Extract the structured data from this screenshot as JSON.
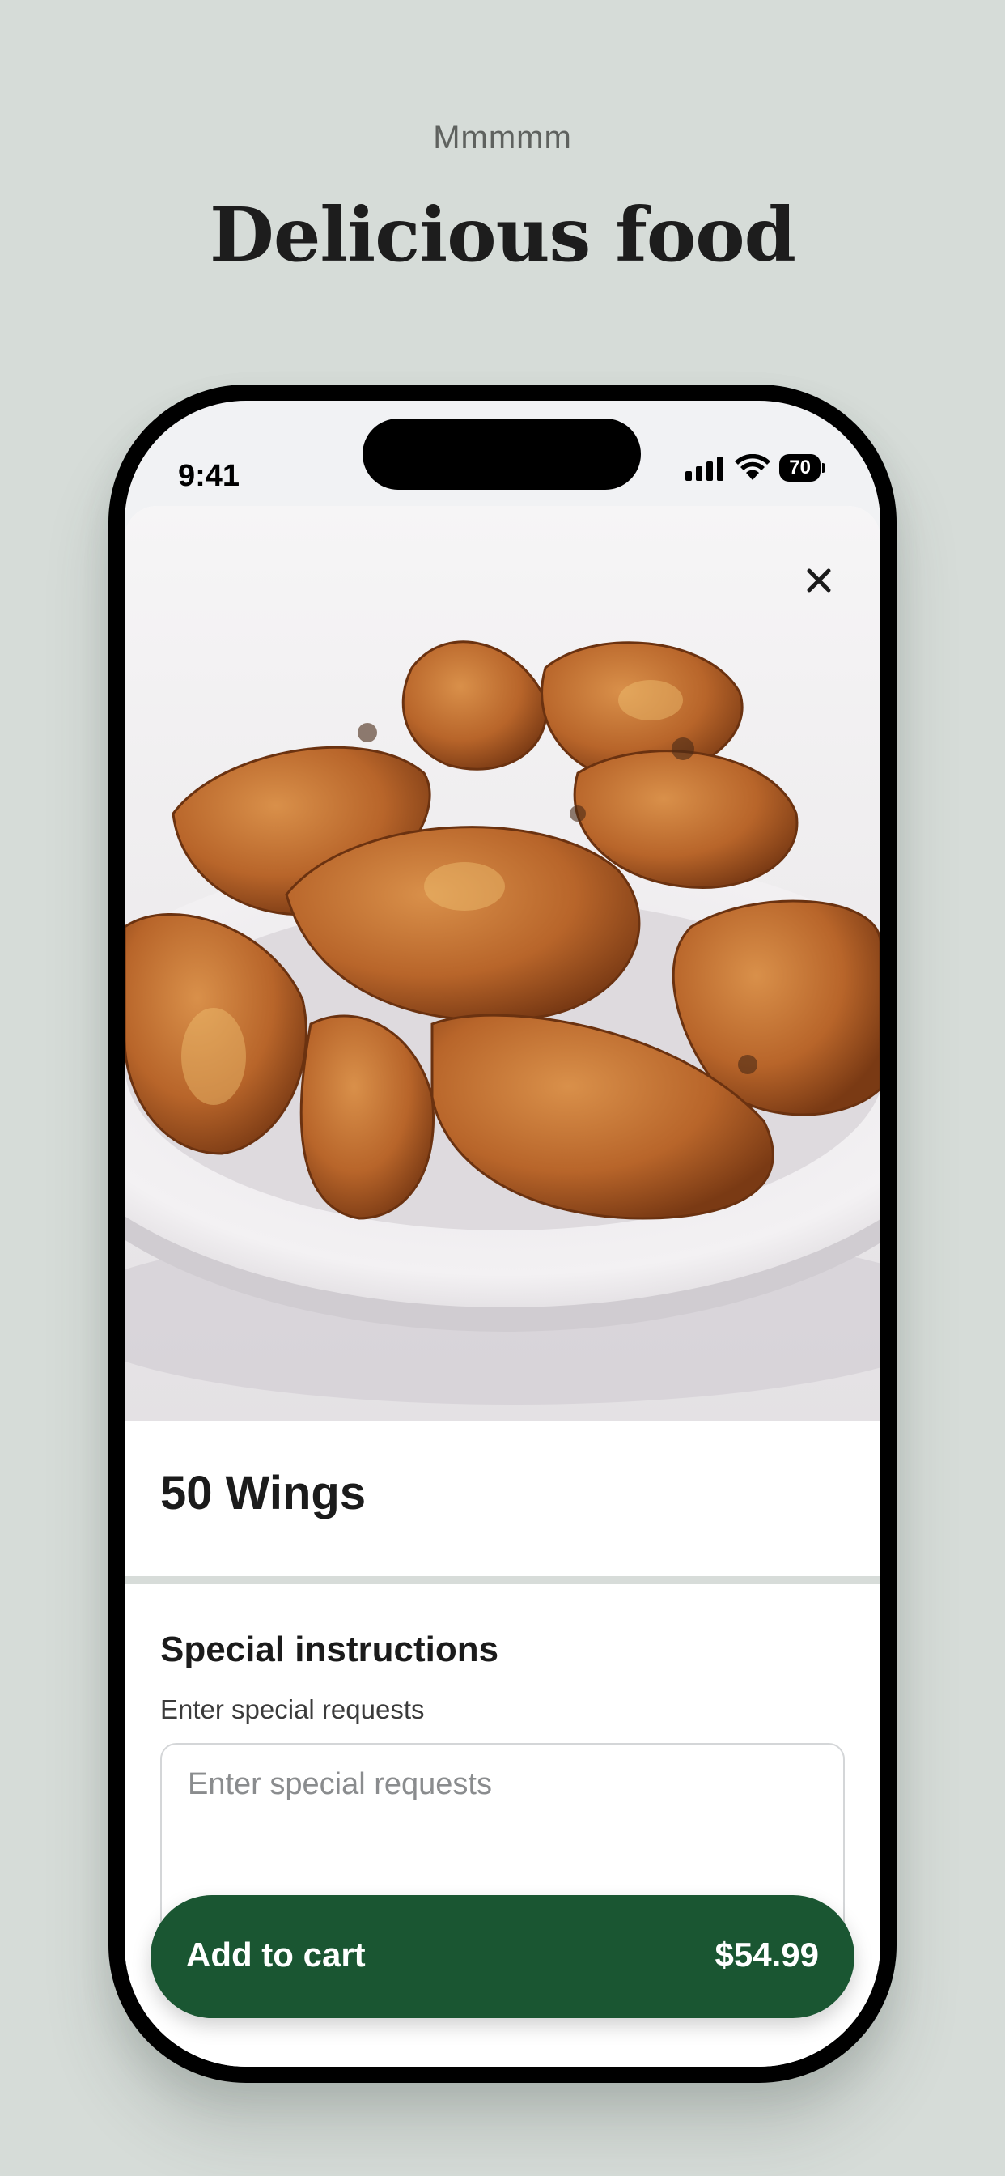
{
  "theme": {
    "background": "#d6dcd8",
    "accent": "#1a5632"
  },
  "header": {
    "kicker": "Mmmmm",
    "headline": "Delicious food"
  },
  "status": {
    "time": "9:41",
    "battery": "70"
  },
  "sheet": {
    "close_icon": "close-icon",
    "item_title": "50 Wings",
    "special_instructions": {
      "title": "Special instructions",
      "subtitle": "Enter special requests",
      "placeholder": "Enter special requests",
      "value": ""
    },
    "cart_button": {
      "label": "Add to cart",
      "price": "$54.99"
    }
  }
}
